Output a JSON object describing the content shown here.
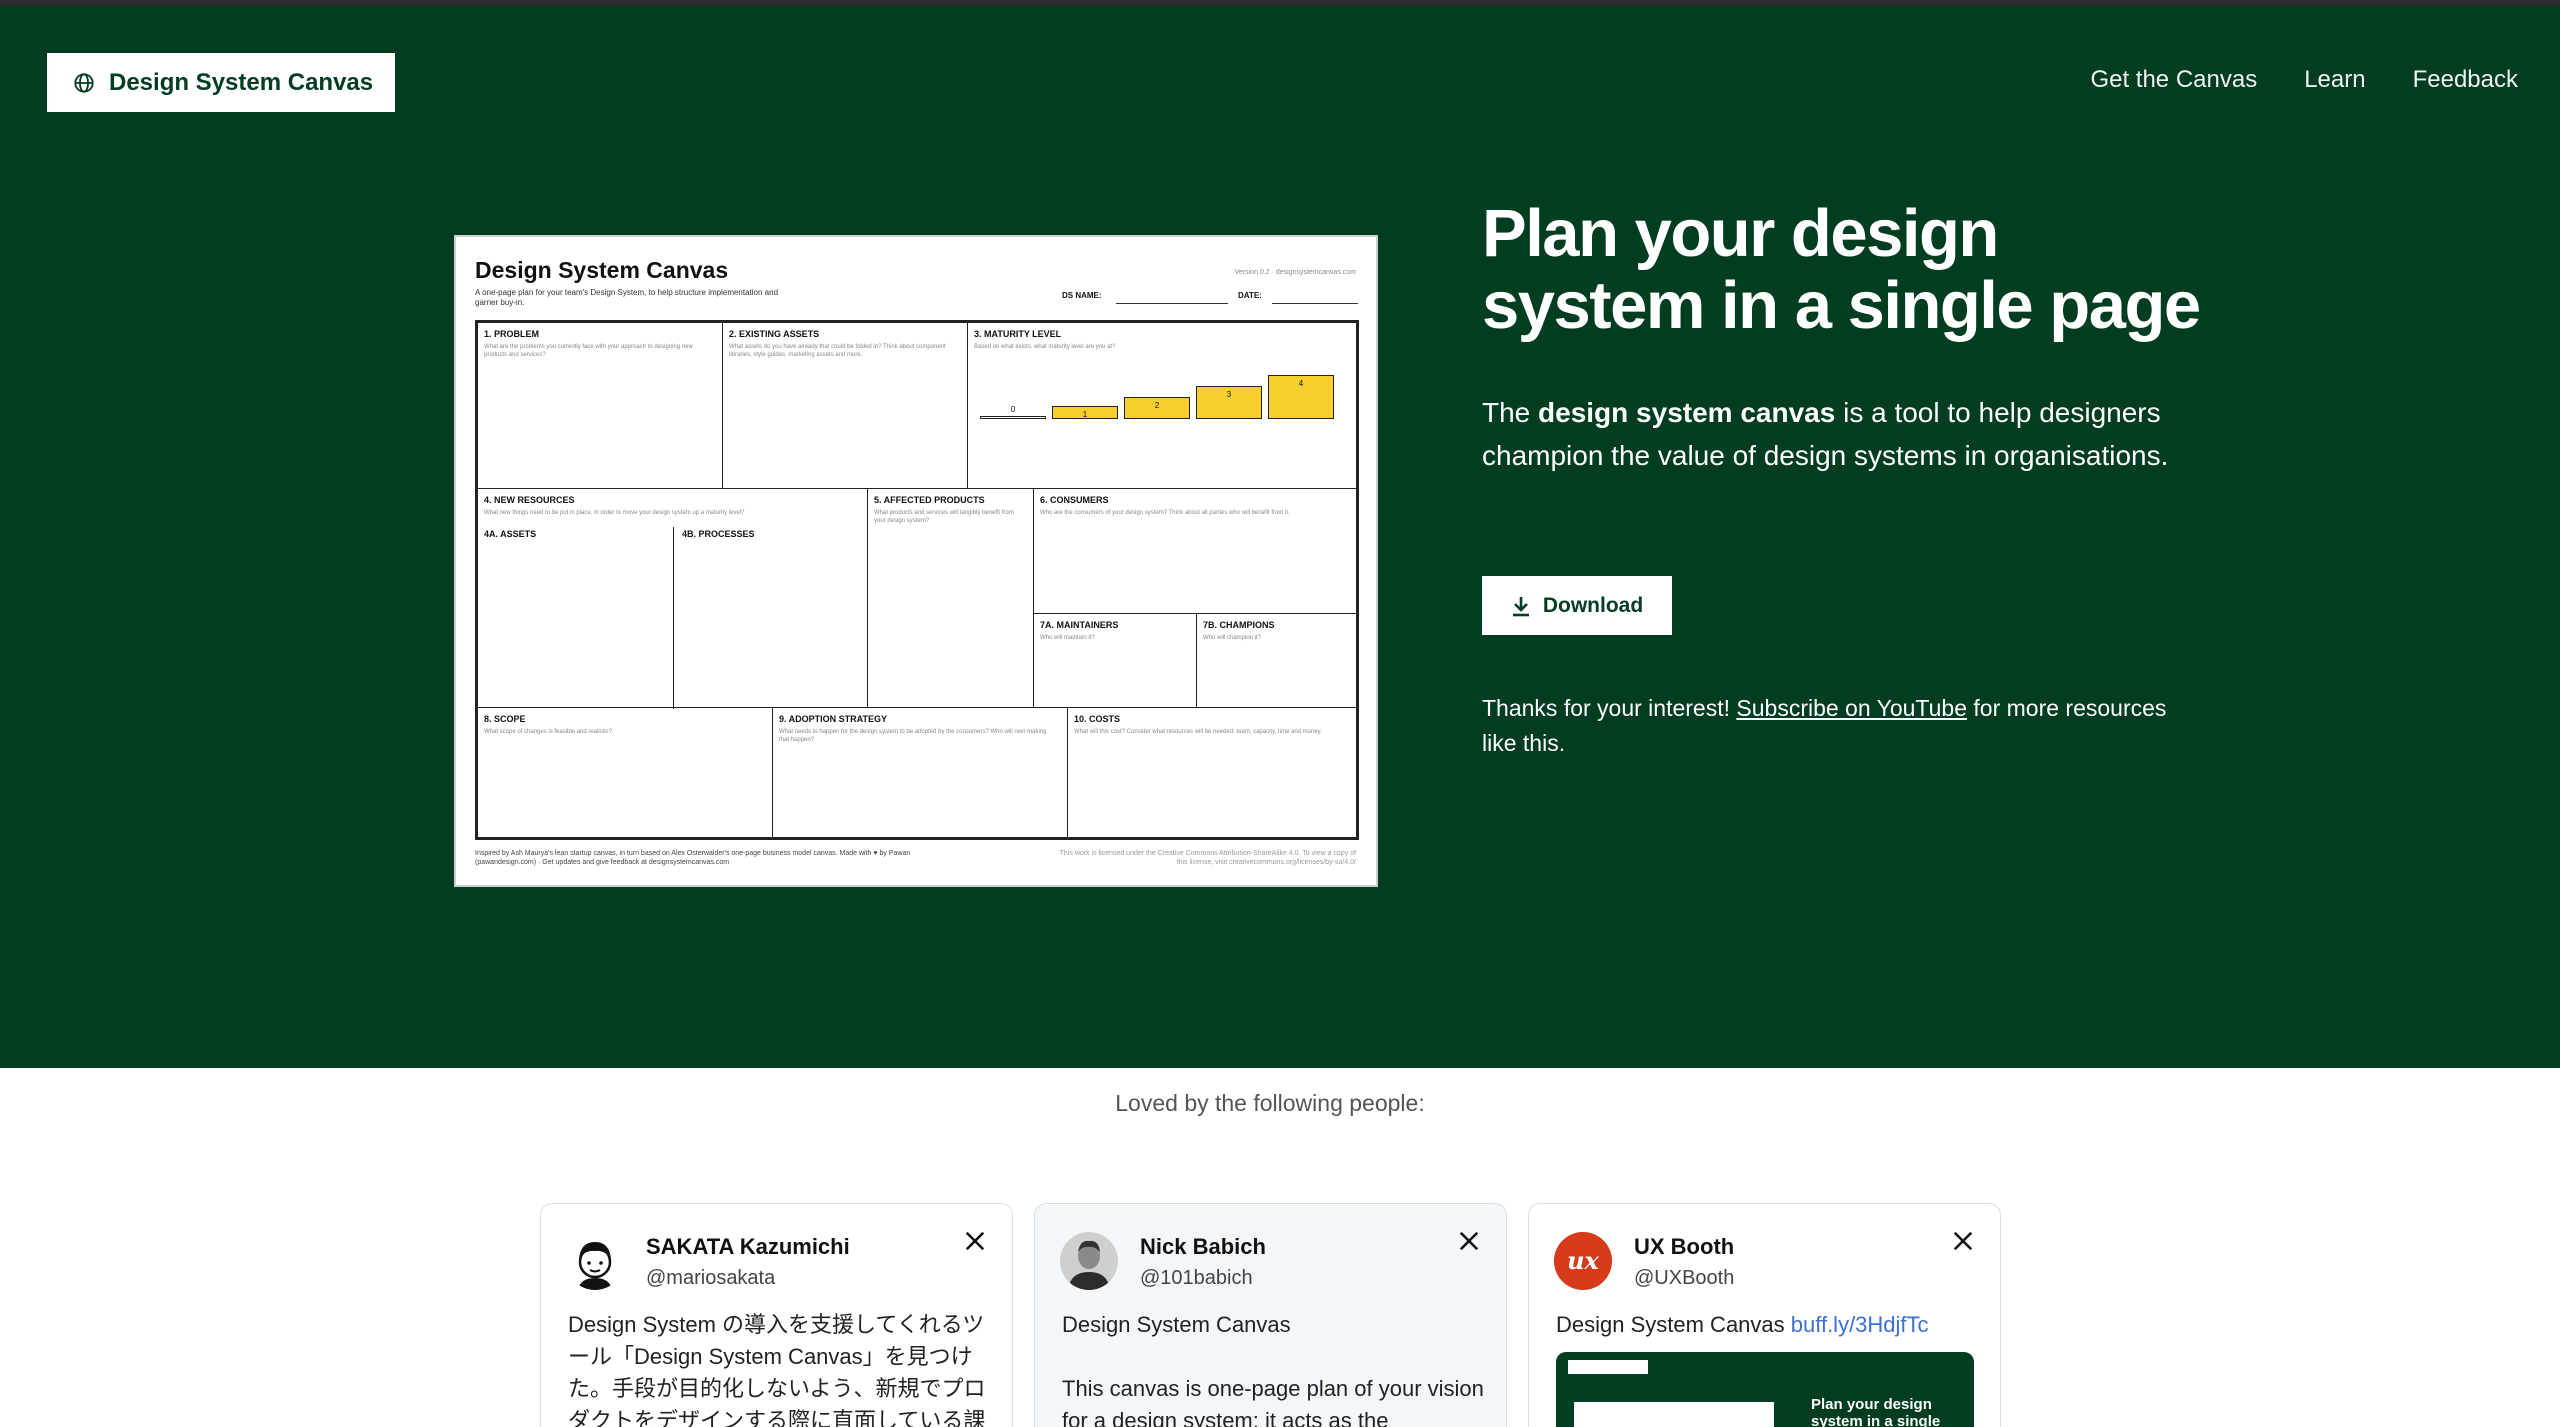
{
  "header": {
    "brand": "Design System Canvas",
    "nav": [
      "Get the Canvas",
      "Learn",
      "Feedback"
    ]
  },
  "canvas_preview": {
    "title": "Design System Canvas",
    "subtitle": "A one-page plan for your team's Design System, to help structure implementation and garner buy-in.",
    "version": "Version 0.2 · designsystemcanvas.com",
    "ds_name_label": "DS NAME:",
    "date_label": "DATE:",
    "sections": {
      "problem": {
        "label": "1. PROBLEM",
        "hint": "What are the problems you currently face with your approach to designing new products and services?"
      },
      "existing": {
        "label": "2. EXISTING ASSETS",
        "hint": "What assets do you have already that could be folded in? Think about component libraries, style guides, marketing assets and more."
      },
      "maturity": {
        "label": "3. MATURITY LEVEL",
        "hint": "Based on what exists, what maturity level are you at?"
      },
      "resources": {
        "label": "4. NEW RESOURCES",
        "hint": "What new things need to be put in place, in order to move your design system up a maturity level?"
      },
      "assets": {
        "label": "4A. ASSETS"
      },
      "processes": {
        "label": "4B. PROCESSES"
      },
      "affected": {
        "label": "5. AFFECTED PRODUCTS",
        "hint": "What products and services will tangibly benefit from your design system?"
      },
      "consumers": {
        "label": "6. CONSUMERS",
        "hint": "Who are the consumers of your design system? Think about all parties who will benefit from it."
      },
      "maintainers": {
        "label": "7A. MAINTAINERS",
        "hint": "Who will maintain it?"
      },
      "champions": {
        "label": "7B. CHAMPIONS",
        "hint": "Who will champion it?"
      },
      "scope": {
        "label": "8. SCOPE",
        "hint": "What scope of changes is feasible and realistic?"
      },
      "adoption": {
        "label": "9. ADOPTION STRATEGY",
        "hint": "What needs to happen for the design system to be adopted by the consumers? Who will own making that happen?"
      },
      "costs": {
        "label": "10. COSTS",
        "hint": "What will this cost? Consider what resources will be needed: team, capacity, time and money."
      }
    },
    "maturity_levels": [
      "0",
      "1",
      "2",
      "3",
      "4"
    ],
    "maturity_fill": [
      0.05,
      0.3,
      0.5,
      0.75,
      1.0
    ],
    "footer_left": "Inspired by Ash Maurya's lean startup canvas, in turn based on Alex Osterwalder's one-page business model canvas. Made with ♥ by Pawan (pawandesign.com) · Get updates and give feedback at designsystemcanvas.com",
    "footer_right": "This work is licensed under the Creative Commons Attribution-ShareAlike 4.0. To view a copy of this license, visit creativecommons.org/licenses/by-sa/4.0/"
  },
  "hero": {
    "headline": "Plan your design system in a single page",
    "intro_prefix": "The ",
    "intro_bold": "design system canvas",
    "intro_suffix": " is a tool to help designers champion the value of design systems in organisations.",
    "download_label": "Download",
    "thanks_prefix": "Thanks for your interest! ",
    "thanks_link": "Subscribe on YouTube",
    "thanks_suffix": " for more resources like this."
  },
  "testimonials": {
    "heading": "Loved by the following people:",
    "cards": [
      {
        "name": "SAKATA Kazumichi",
        "handle": "@mariosakata",
        "text": "Design System の導入を支援してくれるツール「Design System Canvas」を見つけた。手段が目的化しないよう、新規でプロダクトをデザインする際に直面している課"
      },
      {
        "name": "Nick Babich",
        "handle": "@101babich",
        "text1": "Design System Canvas",
        "text2": "This canvas is one-page plan of your vision for a design system; it acts as the"
      },
      {
        "name": "UX Booth",
        "handle": "@UXBooth",
        "text": "Design System Canvas ",
        "link": "buff.ly/3HdjfTc",
        "thumb_headline": "Plan your design system in a single"
      }
    ]
  }
}
